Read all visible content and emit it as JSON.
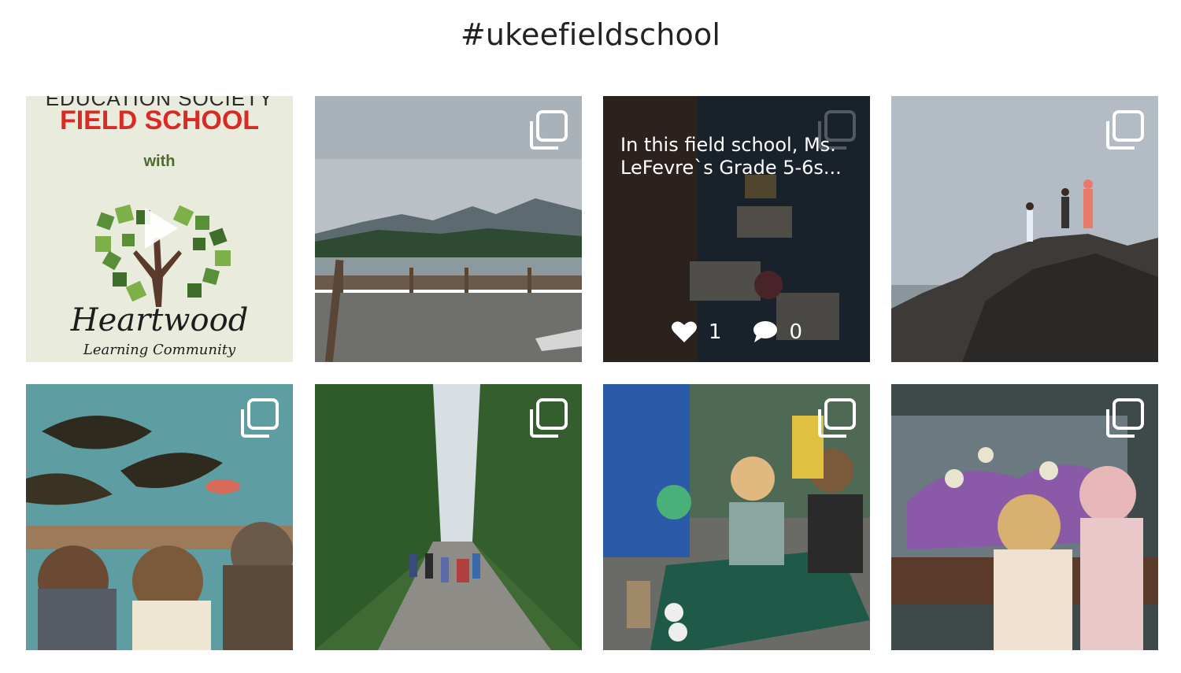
{
  "page": {
    "title": "#ukeefieldschool"
  },
  "tiles": [
    {
      "kind": "video",
      "poster": {
        "line1": "EDUCATION SOCIETY",
        "line2": "FIELD SCHOOL",
        "line3": "with",
        "logo_name": "Heartwood",
        "logo_sub": "Learning Community"
      },
      "icon": "play-icon"
    },
    {
      "kind": "carousel",
      "scene": "harbor-dock",
      "icon": "multiple-images-icon"
    },
    {
      "kind": "carousel-hovered",
      "scene": "craft-table",
      "icon": "multiple-images-icon",
      "caption": "In this field school, Ms. LeFevre`s Grade 5-6s...",
      "likes": "1",
      "comments": "0",
      "like_icon": "heart-icon",
      "comment_icon": "comment-bubble-icon"
    },
    {
      "kind": "carousel",
      "scene": "kids-on-rocks",
      "icon": "multiple-images-icon"
    },
    {
      "kind": "carousel",
      "scene": "aquarium-kelp",
      "icon": "multiple-images-icon"
    },
    {
      "kind": "carousel",
      "scene": "forest-trail",
      "icon": "multiple-images-icon"
    },
    {
      "kind": "carousel",
      "scene": "beach-net",
      "icon": "multiple-images-icon"
    },
    {
      "kind": "carousel",
      "scene": "touch-tank",
      "icon": "multiple-images-icon"
    }
  ],
  "colors": {
    "overlay": "#141414",
    "poster_red": "#d92b26",
    "tree_green": "#5a8f3a"
  }
}
